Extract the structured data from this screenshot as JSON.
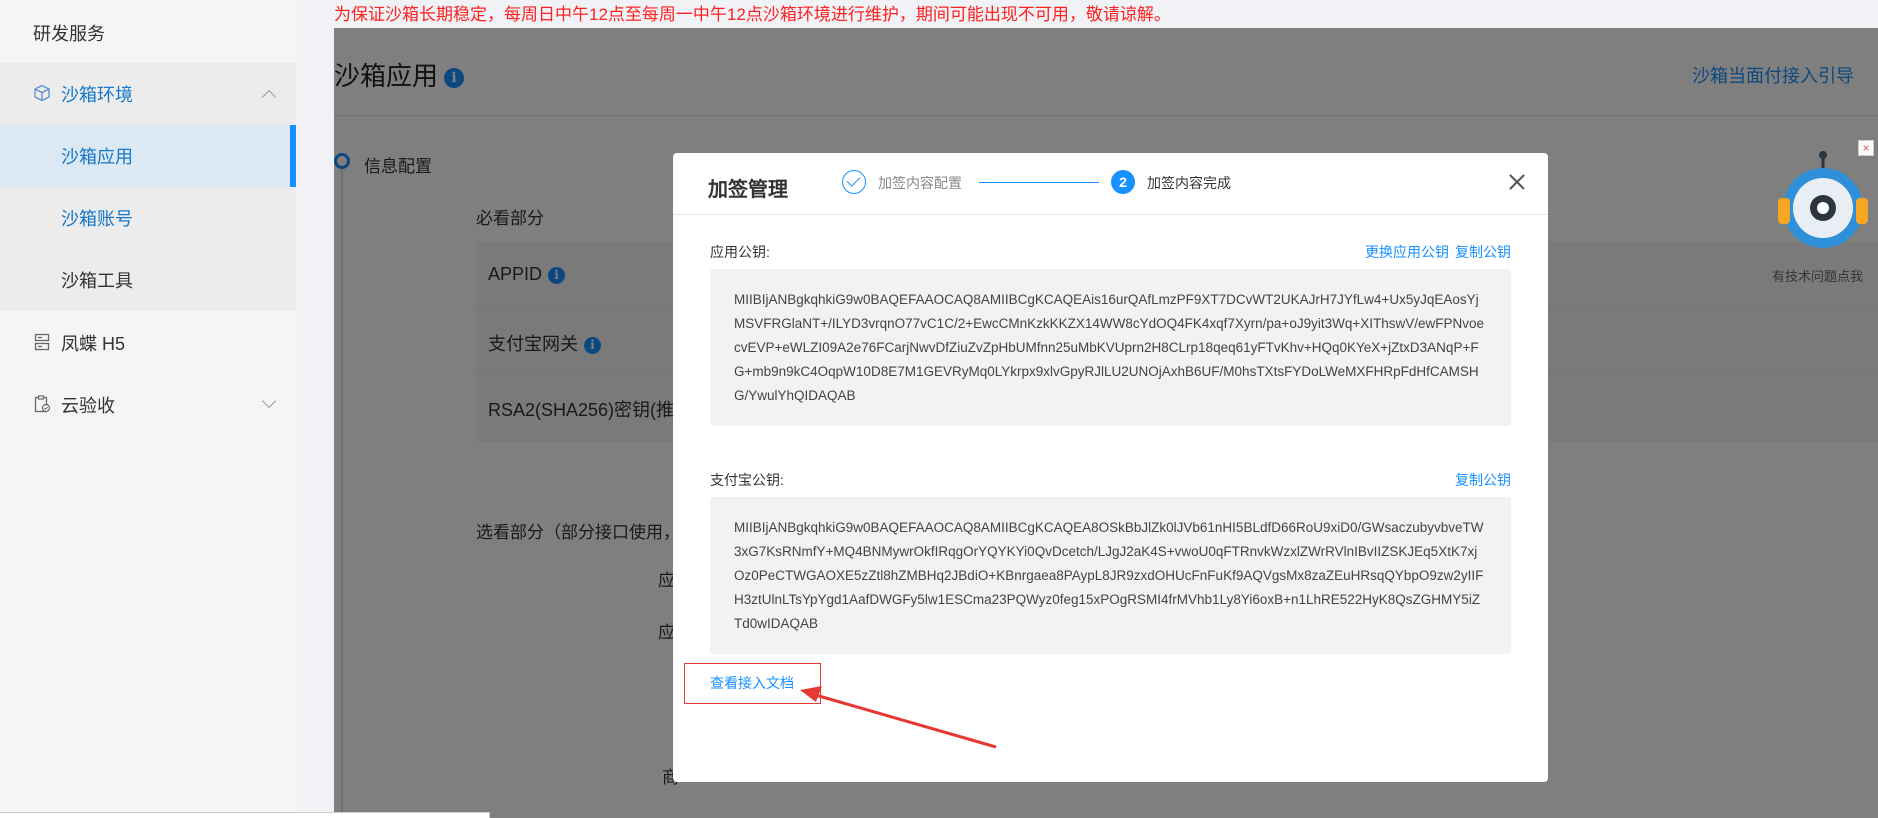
{
  "notice": "为保证沙箱长期稳定，每周日中午12点至每周一中午12点沙箱环境进行维护，期间可能出现不可用，敬请谅解。",
  "sidebar": {
    "items": [
      {
        "label": "研发服务"
      },
      {
        "label": "沙箱环境"
      },
      {
        "label": "沙箱应用"
      },
      {
        "label": "沙箱账号"
      },
      {
        "label": "沙箱工具"
      },
      {
        "label": "凤蝶 H5"
      },
      {
        "label": "云验收"
      }
    ]
  },
  "page": {
    "title": "沙箱应用",
    "info_glyph": "i",
    "guide_link": "沙箱当面付接入引导",
    "section": "信息配置",
    "must_see": "必看部分",
    "fields": [
      "APPID",
      "支付宝网关",
      "RSA2(SHA256)密钥(推荐"
    ],
    "optional": "选看部分（部分接口使用，",
    "truncated": [
      "应",
      "应",
      "商"
    ]
  },
  "modal": {
    "title": "加签管理",
    "steps": [
      {
        "label": "加签内容配置"
      },
      {
        "number": "2",
        "label": "加签内容完成"
      }
    ],
    "app_key": {
      "label": "应用公钥:",
      "actions": [
        "更换应用公钥",
        "复制公钥"
      ],
      "value": "MIIBIjANBgkqhkiG9w0BAQEFAAOCAQ8AMIIBCgKCAQEAis16urQAfLmzPF9XT7DCvWT2UKAJrH7JYfLw4+Ux5yJqEAosYjMSVFRGlaNT+/ILYD3vrqnO77vC1C/2+EwcCMnKzkKKZX14WW8cYdOQ4FK4xqf7Xyrn/pa+oJ9yit3Wq+XIThswV/ewFPNvoecvEVP+eWLZI09A2e76FCarjNwvDfZiuZvZpHbUMfnn25uMbKVUprn2H8CLrp18qeq61yFTvKhv+HQq0KYeX+jZtxD3ANqP+FG+mb9n9kC4OqpW10D8E7M1GEVRyMq0LYkrpx9xlvGpyRJlLU2UNOjAxhB6UF/M0hsTXtsFYDoLWeMXFHRpFdHfCAMSHG/YwulYhQIDAQAB"
    },
    "alipay_key": {
      "label": "支付宝公钥:",
      "actions": [
        "复制公钥"
      ],
      "value": "MIIBIjANBgkqhkiG9w0BAQEFAAOCAQ8AMIIBCgKCAQEA8OSkBbJlZk0lJVb61nHI5BLdfD66RoU9xiD0/GWsaczubyvbveTW3xG7KsRNmfY+MQ4BNMywrOkfIRqgOrYQYKYi0QvDcetch/LJgJ2aK4S+vwoU0qFTRnvkWzxlZWrRVlnIBvIIZSKJEq5XtK7xjOz0PeCTWGAOXE5zZtl8hZMBHq2JBdiO+KBnrgaea8PAypL8JR9zxdOHUcFnFuKf9AQVgsMx8zaZEuHRsqQYbpO9zw2yIIFH3ztUlnLTsYpYgd1AafDWGFy5lw1ESCma23PQWyz0feg15xPOgRSMI4frMVhb1Ly8Yi6oxB+n1LhRE522HyK8QsZGHMY5iZTd0wIDAQAB"
    },
    "doc_link": "查看接入文档",
    "close_glyph": "×"
  },
  "robot": {
    "text": "有技术问题点我",
    "close_glyph": "×"
  }
}
